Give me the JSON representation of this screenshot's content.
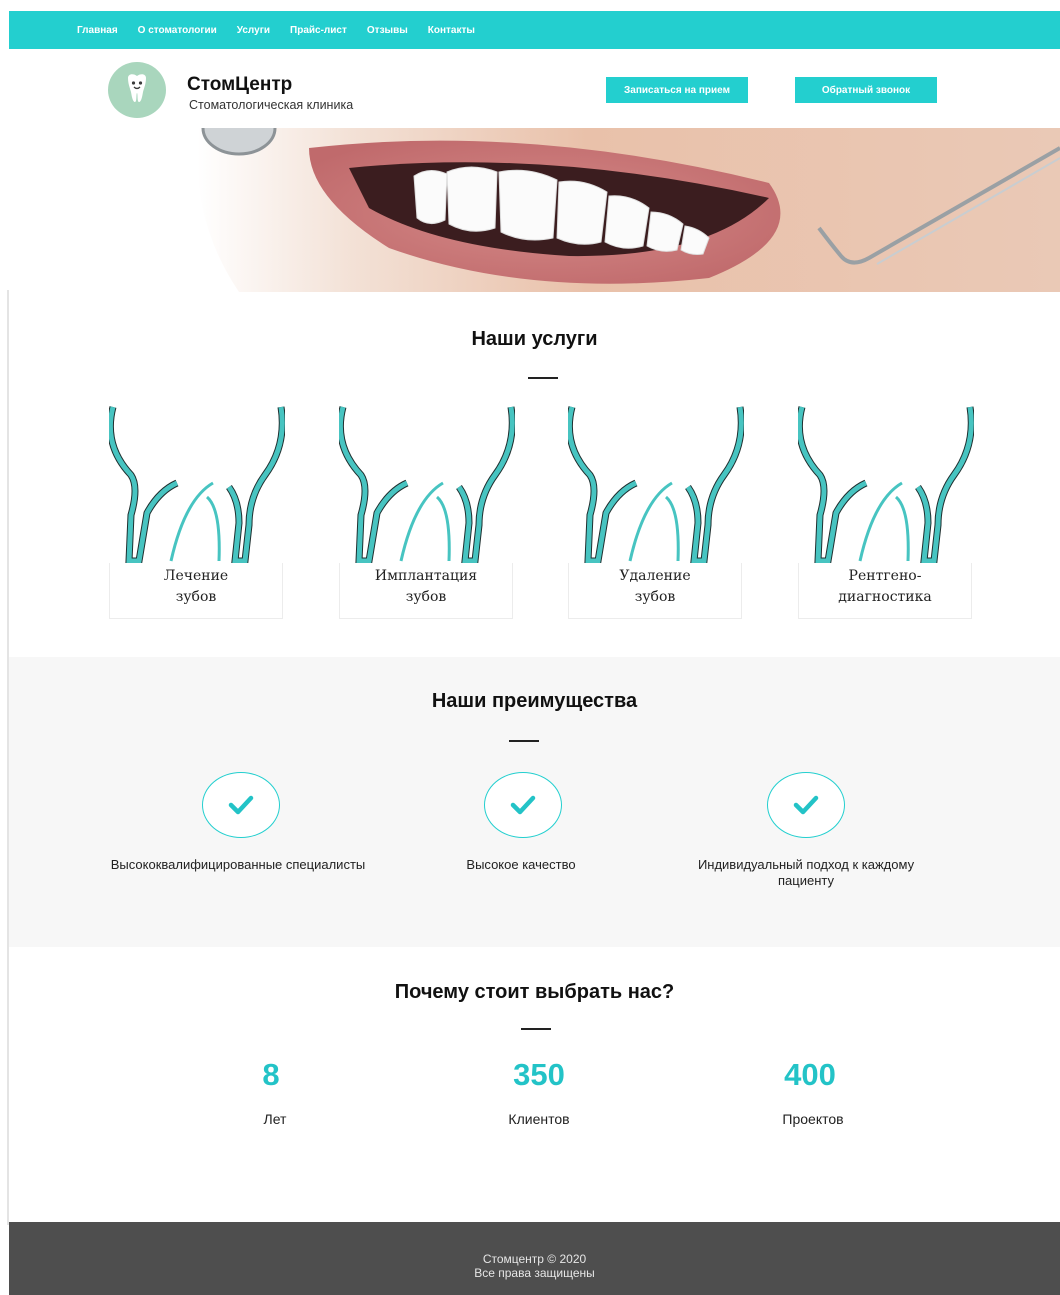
{
  "nav": {
    "items": [
      "Главная",
      "О стоматологии",
      "Услуги",
      "Прайс-лист",
      "Отзывы",
      "Контакты"
    ]
  },
  "header": {
    "brand_name": "СтомЦентр",
    "brand_tagline": "Стоматологическая клиника",
    "appointment_button": "Записаться на прием",
    "callback_button": "Обратный звонок"
  },
  "services": {
    "title": "Наши услуги",
    "items": [
      {
        "line1": "Лечение",
        "line2": "зубов"
      },
      {
        "line1": "Имплантация",
        "line2": "зубов"
      },
      {
        "line1": "Удаление",
        "line2": "зубов"
      },
      {
        "line1": "Рентгено-",
        "line2": "диагностика"
      }
    ]
  },
  "advantages": {
    "title": "Наши преимущества",
    "items": [
      {
        "text": "Высококвалифицированные специалисты",
        "icon": "check-icon"
      },
      {
        "text": "Высокое качество",
        "icon": "check-icon"
      },
      {
        "text": "Индивидуальный подход к каждому пациенту",
        "icon": "check-icon"
      }
    ]
  },
  "stats": {
    "title": "Почему стоит выбрать нас?",
    "items": [
      {
        "value": "8",
        "label": "Лет"
      },
      {
        "value": "350",
        "label": "Клиентов"
      },
      {
        "value": "400",
        "label": "Проектов"
      }
    ]
  },
  "footer": {
    "copyright": "Стомцентр © 2020",
    "rights": "Все права защищены"
  },
  "colors": {
    "accent": "#23cfcf",
    "footer_bg": "#4e4e4e",
    "band_bg": "#f7f7f7",
    "logo_bg": "#a9d6bd"
  }
}
